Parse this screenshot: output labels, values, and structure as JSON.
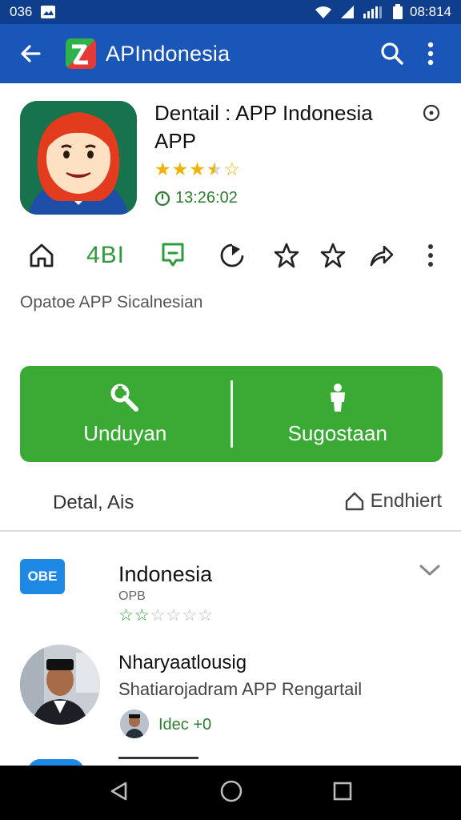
{
  "status_bar": {
    "time_left": "036",
    "time_right": "08:814"
  },
  "app_bar": {
    "title": "APIndonesia"
  },
  "app": {
    "title": "Dentail : APP Indonesia APP",
    "rating": 3.5,
    "timer": "13:26:02"
  },
  "actions": {
    "count": "4BI"
  },
  "description": "Opatoe APP Sicalnesian",
  "primary_buttons": {
    "download_label": "Unduyan",
    "suggest_label": "Sugostaan"
  },
  "details_row": {
    "label": "Detal, Ais",
    "endorse_label": "Endhiert"
  },
  "list": [
    {
      "title": "Indonesia",
      "subtitle": "OPB",
      "logo_text": "OBE",
      "stars_filled": 2,
      "stars_total": 6
    },
    {
      "title": "Nharyaatlousig",
      "subtitle": "Shatiarojadram APP Rengartail",
      "tag": "Idec +",
      "tag_suffix": "0"
    }
  ],
  "colors": {
    "status_bar": "#0f3f8c",
    "app_bar": "#1a56b8",
    "primary_green": "#3aaa35",
    "accent_green": "#2e9b3a",
    "star_gold": "#f0b400"
  },
  "icons": {
    "back": "arrow-left-icon",
    "search": "search-icon",
    "more": "more-vert-icon",
    "info": "info-icon",
    "home": "home-icon",
    "bookmark": "bookmark-icon",
    "history": "refresh-icon",
    "star": "star-icon",
    "share": "share-icon"
  }
}
